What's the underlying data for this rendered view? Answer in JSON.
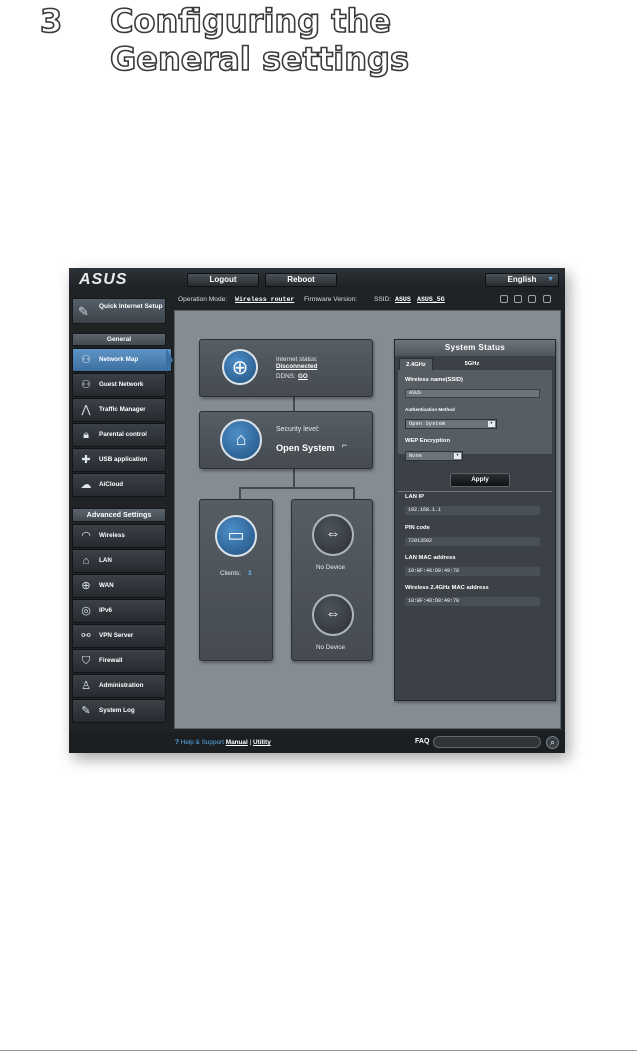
{
  "heading": {
    "number": "3",
    "title": "Configuring the General settings"
  },
  "topbar": {
    "logo": "ASUS",
    "logout_label": "Logout",
    "reboot_label": "Reboot",
    "language": "English"
  },
  "infobar": {
    "operation_mode_label": "Operation Mode:",
    "operation_mode_value": "Wireless router",
    "firmware_label": "Firmware Version:",
    "ssid_label": "SSID:",
    "ssid_1": "ASUS",
    "ssid_2": "ASUS_5G"
  },
  "sidebar": {
    "quick_setup": "Quick Internet Setup",
    "general_header": "General",
    "general_items": [
      {
        "label": "Network Map",
        "icon": "network-map-icon"
      },
      {
        "label": "Guest Network",
        "icon": "guest-network-icon"
      },
      {
        "label": "Traffic Manager",
        "icon": "traffic-manager-icon"
      },
      {
        "label": "Parental control",
        "icon": "parental-control-icon"
      },
      {
        "label": "USB application",
        "icon": "usb-application-icon"
      },
      {
        "label": "AiCloud",
        "icon": "aicloud-icon"
      }
    ],
    "advanced_header": "Advanced Settings",
    "advanced_items": [
      {
        "label": "Wireless",
        "icon": "wireless-icon"
      },
      {
        "label": "LAN",
        "icon": "lan-icon"
      },
      {
        "label": "WAN",
        "icon": "wan-icon"
      },
      {
        "label": "IPv6",
        "icon": "ipv6-icon"
      },
      {
        "label": "VPN Server",
        "icon": "vpn-server-icon"
      },
      {
        "label": "Firewall",
        "icon": "firewall-icon"
      },
      {
        "label": "Administration",
        "icon": "administration-icon"
      },
      {
        "label": "System Log",
        "icon": "system-log-icon"
      }
    ]
  },
  "network_map": {
    "internet_status_label": "Internet status:",
    "internet_status_value": "Disconnected",
    "ddns_label": "DDNS:",
    "ddns_value": "GO",
    "security_label": "Security level:",
    "security_value": "Open System",
    "clients_label": "Clients:",
    "clients_count": "3",
    "usb_1": "No Device",
    "usb_2": "No Device"
  },
  "system_status": {
    "title": "System Status",
    "tab_24": "2.4GHz",
    "tab_5": "5GHz",
    "ssid_label": "Wireless name(SSID)",
    "ssid_value": "ASUS",
    "auth_label": "Authentication Method",
    "auth_value": "Open System",
    "wep_label": "WEP Encryption",
    "wep_value": "None",
    "apply_label": "Apply",
    "lan_ip_label": "LAN IP",
    "lan_ip_value": "192.168.1.1",
    "pin_label": "PIN code",
    "pin_value": "72013502",
    "lan_mac_label": "LAN MAC address",
    "lan_mac_value": "10:BF:48:D8:49:78",
    "wl_mac_label": "Wireless 2.4GHz MAC address",
    "wl_mac_value": "10:BF:48:D8:49:78"
  },
  "footer": {
    "help_label": "Help & Support",
    "manual": "Manual",
    "separator": "|",
    "utility": "Utility",
    "faq": "FAQ"
  }
}
